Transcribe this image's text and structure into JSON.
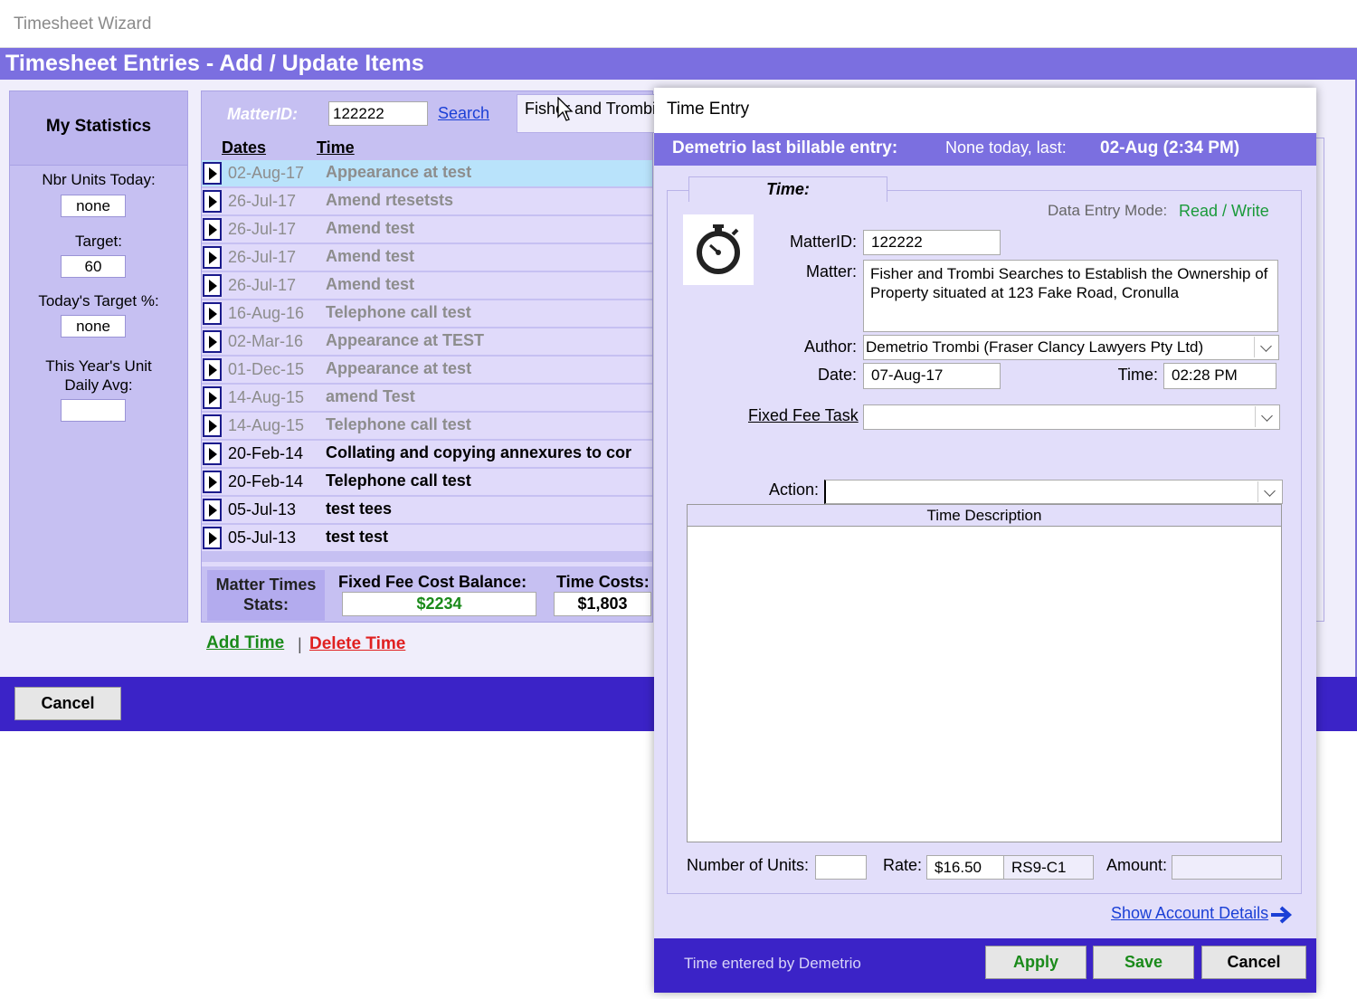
{
  "window": {
    "title": "Timesheet Wizard"
  },
  "header": {
    "title": "Timesheet Entries - Add / Update Items"
  },
  "stats": {
    "title": "My Statistics",
    "units_today_label": "Nbr Units Today:",
    "units_today_value": "none",
    "target_label": "Target:",
    "target_value": "60",
    "target_pct_label": "Today's Target %:",
    "target_pct_value": "none",
    "daily_avg_label_1": "This Year's Unit",
    "daily_avg_label_2": "Daily Avg:",
    "daily_avg_value": ""
  },
  "list": {
    "matter_label": "MatterID:",
    "matter_value": "122222",
    "search_label": "Search",
    "matter_name": "Fisher and Trombi",
    "col_dates": "Dates",
    "col_time": "Time",
    "rows": [
      {
        "date": "02-Aug-17",
        "desc": "Appearance at test",
        "style": "grey selected"
      },
      {
        "date": "26-Jul-17",
        "desc": "Amend rtesetsts",
        "style": "grey"
      },
      {
        "date": "26-Jul-17",
        "desc": "Amend test",
        "style": "grey"
      },
      {
        "date": "26-Jul-17",
        "desc": "Amend test",
        "style": "grey"
      },
      {
        "date": "26-Jul-17",
        "desc": "Amend test",
        "style": "grey"
      },
      {
        "date": "16-Aug-16",
        "desc": "Telephone call test",
        "style": "grey"
      },
      {
        "date": "02-Mar-16",
        "desc": "Appearance at TEST",
        "style": "grey"
      },
      {
        "date": "01-Dec-15",
        "desc": "Appearance at test",
        "style": "grey"
      },
      {
        "date": "14-Aug-15",
        "desc": "amend Test",
        "style": "grey"
      },
      {
        "date": "14-Aug-15",
        "desc": "Telephone call test",
        "style": "grey"
      },
      {
        "date": "20-Feb-14",
        "desc": "Collating and copying annexures to cor",
        "style": ""
      },
      {
        "date": "20-Feb-14",
        "desc": "Telephone call test",
        "style": ""
      },
      {
        "date": "05-Jul-13",
        "desc": "test tees",
        "style": ""
      },
      {
        "date": "05-Jul-13",
        "desc": "test test",
        "style": ""
      }
    ],
    "stats_label": "Matter Times Stats:",
    "ffcb_label": "Fixed Fee Cost Balance:",
    "ffcb_value": "$2234",
    "time_costs_label": "Time Costs:",
    "time_costs_value": "$1,803"
  },
  "actions": {
    "add_time": "Add Time",
    "separator": "|",
    "delete_time": "Delete Time",
    "cancel": "Cancel"
  },
  "dialog": {
    "title": "Time Entry",
    "last_entry_label": "Demetrio last billable entry:",
    "last_entry_none": "None today, last:",
    "last_entry_value": "02-Aug (2:34 PM)",
    "time_tab": "Time:",
    "data_entry_mode_label": "Data Entry Mode:",
    "data_entry_mode_value": "Read / Write",
    "matterid_label": "MatterID:",
    "matterid_value": "122222",
    "matter_label": "Matter:",
    "matter_value": "Fisher and Trombi Searches to Establish the Ownership of Property situated at 123 Fake Road, Cronulla",
    "author_label": "Author:",
    "author_value": "Demetrio Trombi (Fraser Clancy Lawyers Pty Ltd)",
    "date_label": "Date:",
    "date_value": "07-Aug-17",
    "time_label": "Time:",
    "time_value": "02:28 PM",
    "fixed_fee_task_label": "Fixed Fee Task",
    "fixed_fee_task_value": "",
    "action_label": "Action:",
    "action_value": "",
    "time_description_label": "Time Description",
    "time_description_value": "",
    "units_label": "Number of Units:",
    "units_value": "",
    "rate_label": "Rate:",
    "rate_value": "$16.50",
    "rate_code": "RS9-C1",
    "amount_label": "Amount:",
    "amount_value": "",
    "show_account_details": "Show Account Details",
    "entered_by": "Time entered by Demetrio",
    "apply": "Apply",
    "save": "Save",
    "cancel": "Cancel"
  }
}
